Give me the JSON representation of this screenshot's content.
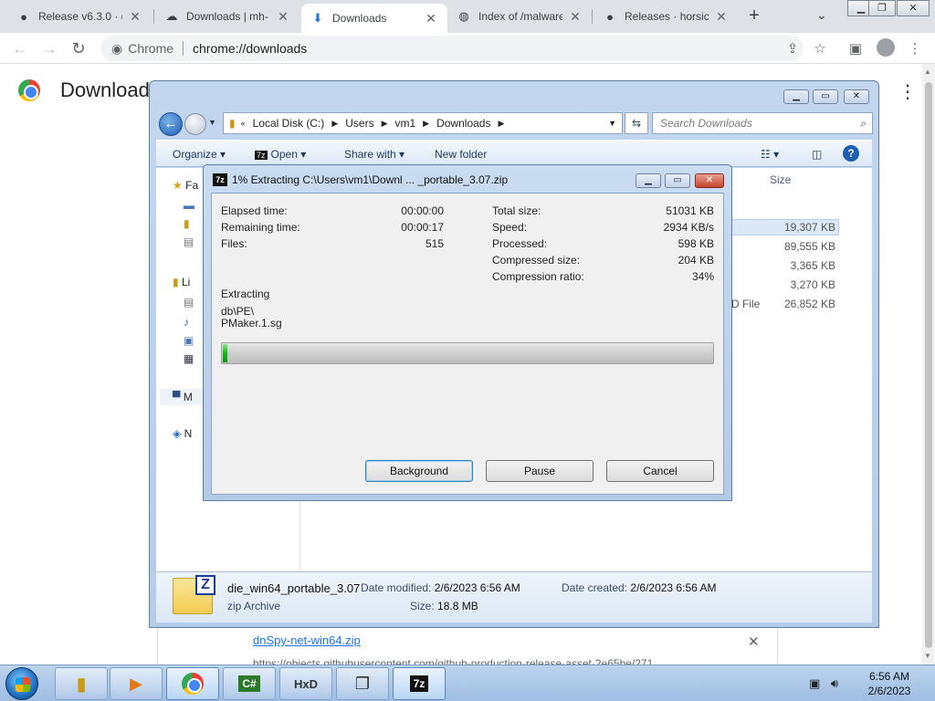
{
  "chrome": {
    "tabs": [
      {
        "label": "Release v6.3.0 · d",
        "icon": "github-icon"
      },
      {
        "label": "Downloads | mh-",
        "icon": "cloud-icon"
      },
      {
        "label": "Downloads",
        "icon": "download-icon"
      },
      {
        "label": "Index of /malware",
        "icon": "globe-icon"
      },
      {
        "label": "Releases · horsicq",
        "icon": "github-icon"
      }
    ],
    "omnibox": {
      "chip": "Chrome",
      "url": "chrome://downloads"
    },
    "page_title": "Download",
    "download_card": {
      "link": "dnSpy-net-win64.zip",
      "url": "https://objects.githubusercontent.com/github-production-release-asset-2e65be/271"
    }
  },
  "explorer": {
    "breadcrumb": [
      "Local Disk (C:)",
      "Users",
      "vm1",
      "Downloads"
    ],
    "search_placeholder": "Search Downloads",
    "commands": {
      "organize": "Organize",
      "open": "Open",
      "share": "Share with",
      "new_folder": "New folder"
    },
    "column_size": "Size",
    "nav": {
      "favorites": "Fa",
      "libraries": "Li",
      "computer": "M",
      "network": "N"
    },
    "partial_type": "D File",
    "sizes": [
      "19,307 KB",
      "89,555 KB",
      "3,365 KB",
      "3,270 KB",
      "26,852 KB"
    ],
    "details": {
      "name": "die_win64_portable_3.07",
      "type": "zip Archive",
      "modified_label": "Date modified:",
      "modified": "2/6/2023 6:56 AM",
      "created_label": "Date created:",
      "created": "2/6/2023 6:56 AM",
      "size_label": "Size:",
      "size": "18.8 MB"
    }
  },
  "sevenzip": {
    "title": "1% Extracting C:\\Users\\vm1\\Downl ... _portable_3.07.zip",
    "left": [
      {
        "label": "Elapsed time:",
        "value": "00:00:00"
      },
      {
        "label": "Remaining time:",
        "value": "00:00:17"
      },
      {
        "label": "Files:",
        "value": "515"
      }
    ],
    "right": [
      {
        "label": "Total size:",
        "value": "51031 KB"
      },
      {
        "label": "Speed:",
        "value": "2934 KB/s"
      },
      {
        "label": "Processed:",
        "value": "598 KB"
      },
      {
        "label": "Compressed size:",
        "value": "204 KB"
      },
      {
        "label": "Compression ratio:",
        "value": "34%"
      }
    ],
    "status": "Extracting",
    "path": "db\\PE\\",
    "file": "PMaker.1.sg",
    "progress_percent": 1,
    "buttons": {
      "background": "Background",
      "pause": "Pause",
      "cancel": "Cancel"
    }
  },
  "taskbar": {
    "apps": [
      "explorer-icon",
      "media-player-icon",
      "chrome-icon",
      "csharp-icon",
      "hxd-icon",
      "windows-icon",
      "7zip-icon"
    ],
    "time": "6:56 AM",
    "date": "2/6/2023"
  }
}
